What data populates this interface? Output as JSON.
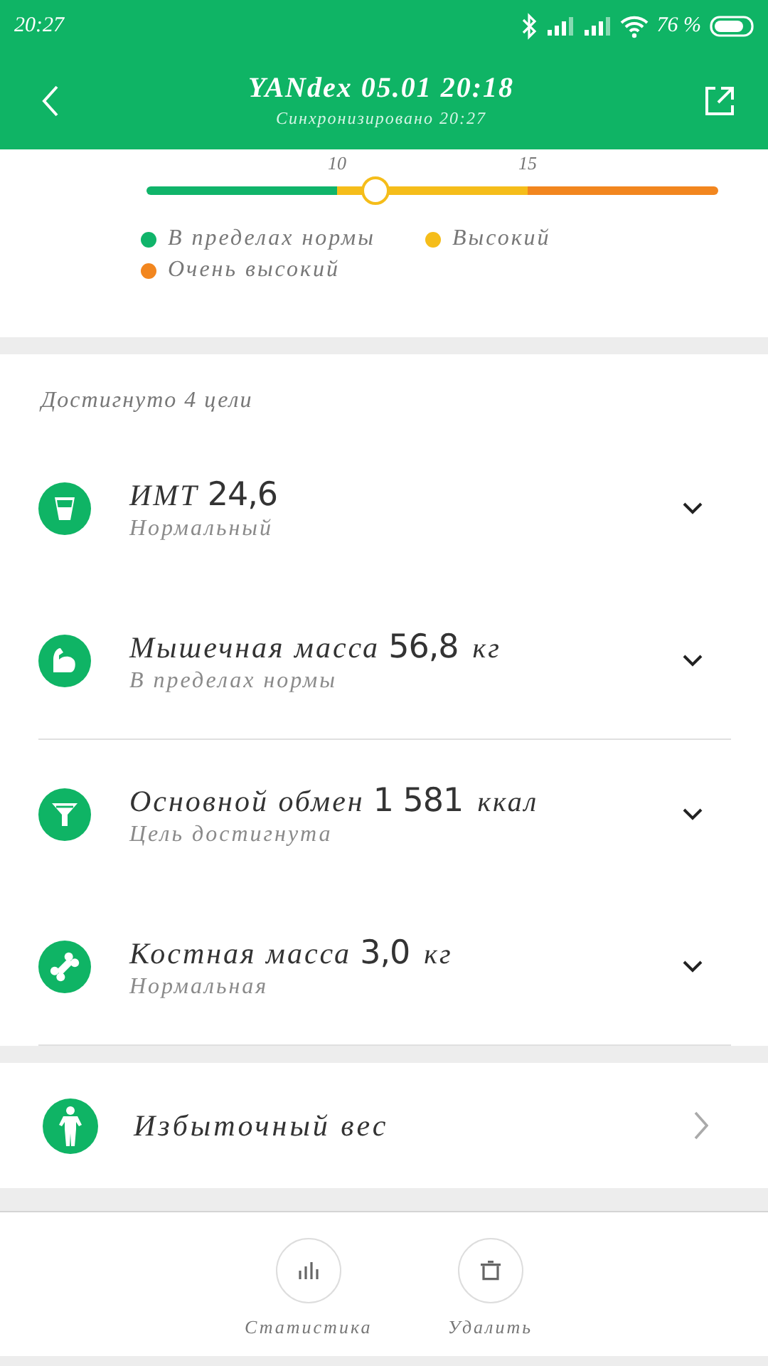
{
  "status_bar": {
    "time": "20:27",
    "battery": "76 %"
  },
  "header": {
    "title": "YANdex 05.01 20:18",
    "subtitle": "Синхронизировано 20:27"
  },
  "scale": {
    "ticks": [
      "10",
      "15"
    ],
    "level": 0.4,
    "legend": [
      {
        "label": "В пределах нормы",
        "color": "#10b46a"
      },
      {
        "label": "Высокий",
        "color": "#f5bd1a"
      },
      {
        "label": "Очень высокий",
        "color": "#f2861f"
      }
    ]
  },
  "goals": {
    "title": "Достигнуто 4 цели",
    "groups": [
      [
        {
          "name": "ИМТ",
          "value": "24,6",
          "status": "Нормальный"
        },
        {
          "name": "Мышечная масса",
          "value": "56,8",
          "unit": "кг",
          "status": "В пределах нормы"
        }
      ],
      [
        {
          "name": "Основной обмен",
          "value": "1 581",
          "unit": "ккал",
          "status": "Цель достигнута"
        },
        {
          "name": "Костная масса",
          "value": "3,0",
          "unit": "кг",
          "status": "Нормальная"
        }
      ]
    ]
  },
  "body_type": {
    "label": "Избыточный вес"
  },
  "actions": [
    {
      "label": "Статистика"
    },
    {
      "label": "Удалить"
    }
  ]
}
